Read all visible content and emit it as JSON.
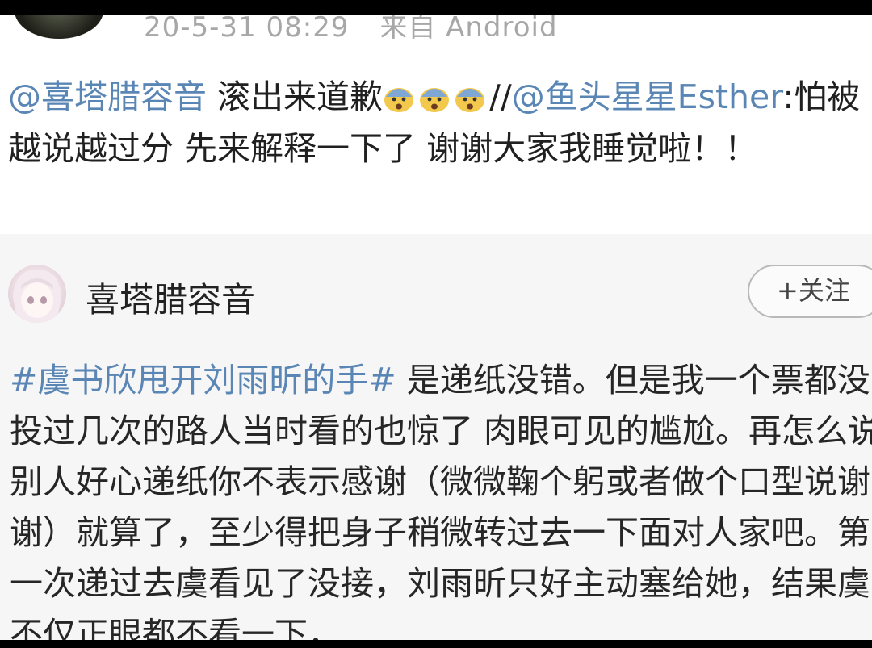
{
  "post": {
    "timestamp": "20-5-31 08:29",
    "source": "来自 Android"
  },
  "repost": {
    "mention1": "@喜塔腊容音",
    "text1": " 滚出来道歉",
    "separator": "//",
    "mention2": "@鱼头星星Esther",
    "text2": ":怕被越说越过分 先来解释一下了 谢谢大家我睡觉啦！！",
    "emoji_icon": "fearful-face-emoji"
  },
  "original": {
    "username": "喜塔腊容音",
    "follow_label": "+关注",
    "hashtag": "#虞书欣甩开刘雨昕的手#",
    "body": " 是递纸没错。但是我一个票都没投过几次的路人当时看的也惊了 肉眼可见的尴尬。再怎么说别人好心递纸你不表示感谢（微微鞠个躬或者做个口型说谢谢）就算了，至少得把身子稍微转过去一下面对人家吧。第一次递过去虞看见了没接，刘雨昕只好主动塞给她，结果虞不仅正眼都不看一下，"
  },
  "colors": {
    "link": "#5a86b5",
    "meta_text": "#a7a7a7",
    "card_bg": "#f6f6f6"
  }
}
